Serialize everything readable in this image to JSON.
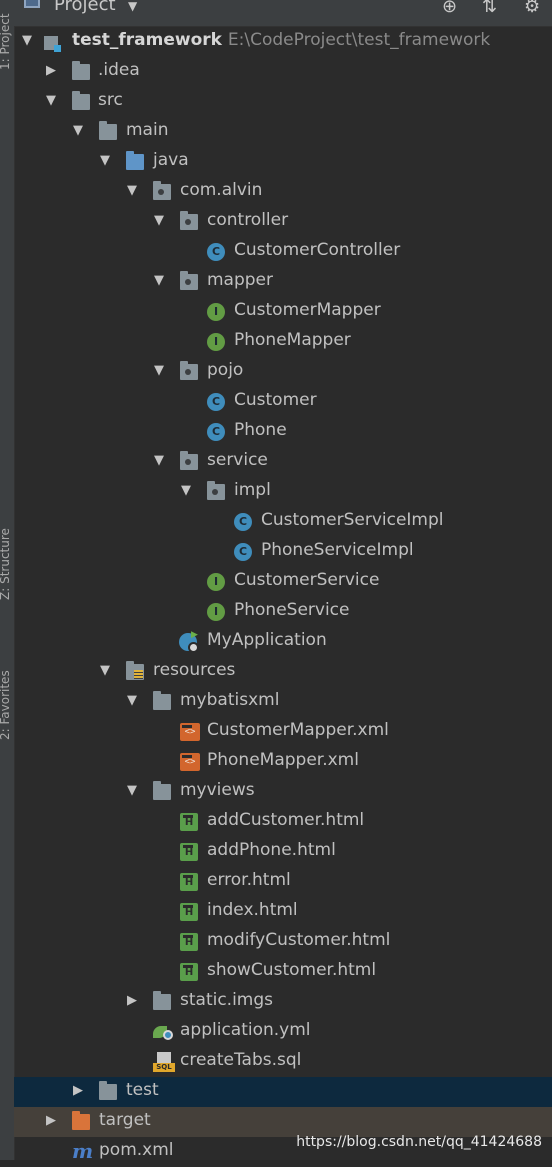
{
  "side_tabs": [
    "1: Project",
    "Z: Structure",
    "2: Favorites"
  ],
  "header": {
    "title": "Project",
    "dropdown_icon": "caret-down-icon",
    "buttons": [
      "crosshair-icon",
      "collapse-icon",
      "gear-icon"
    ]
  },
  "tree": {
    "root": {
      "name": "test_framework",
      "path": "E:\\CodeProject\\test_framework"
    },
    "idea": ".idea",
    "src": "src",
    "main": "main",
    "java": "java",
    "pkg": "com.alvin",
    "controller": "controller",
    "customer_controller": "CustomerController",
    "mapper": "mapper",
    "customer_mapper": "CustomerMapper",
    "phone_mapper": "PhoneMapper",
    "pojo": "pojo",
    "customer": "Customer",
    "phone": "Phone",
    "service": "service",
    "impl": "impl",
    "customer_service_impl": "CustomerServiceImpl",
    "phone_service_impl": "PhoneServiceImpl",
    "customer_service": "CustomerService",
    "phone_service": "PhoneService",
    "my_application": "MyApplication",
    "resources": "resources",
    "mybatisxml": "mybatisxml",
    "customer_mapper_xml": "CustomerMapper.xml",
    "phone_mapper_xml": "PhoneMapper.xml",
    "myviews": "myviews",
    "add_customer_html": "addCustomer.html",
    "add_phone_html": "addPhone.html",
    "error_html": "error.html",
    "index_html": "index.html",
    "modify_customer_html": "modifyCustomer.html",
    "show_customer_html": "showCustomer.html",
    "static_imgs": "static.imgs",
    "application_yml": "application.yml",
    "create_tabs_sql": "createTabs.sql",
    "test": "test",
    "target": "target",
    "pom": "pom.xml"
  },
  "watermark": "https://blog.csdn.net/qq_41424688"
}
